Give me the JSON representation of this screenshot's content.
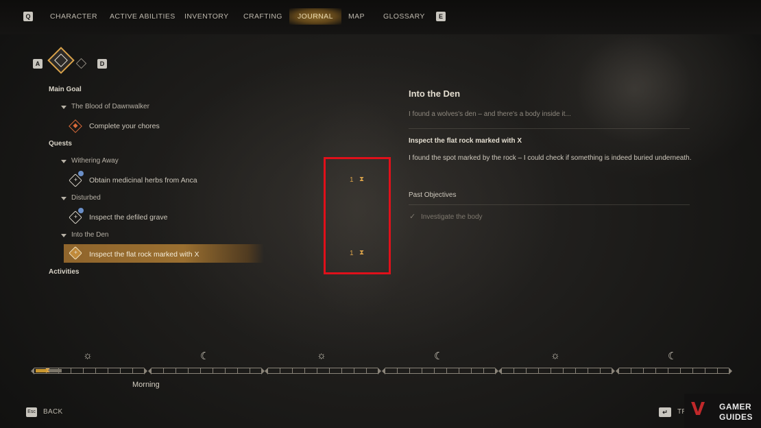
{
  "nav": {
    "left_key": "Q",
    "right_key": "E",
    "tabs": [
      {
        "label": "CHARACTER"
      },
      {
        "label": "ACTIVE ABILITIES"
      },
      {
        "label": "INVENTORY"
      },
      {
        "label": "CRAFTING"
      },
      {
        "label": "JOURNAL"
      },
      {
        "label": "MAP"
      },
      {
        "label": "GLOSSARY"
      }
    ],
    "active_tab": "JOURNAL"
  },
  "subnav": {
    "left_key": "A",
    "right_key": "D"
  },
  "journal": {
    "sections": {
      "main_goal": "Main Goal",
      "quests": "Quests",
      "activities": "Activities"
    },
    "main_goal_quest": "The Blood of Dawnwalker",
    "main_goal_objective": "Complete your chores",
    "quests": [
      {
        "name": "Withering Away",
        "objective": "Obtain medicinal herbs from Anca",
        "timer": "1"
      },
      {
        "name": "Disturbed",
        "objective": "Inspect the defiled grave"
      },
      {
        "name": "Into the Den",
        "objective": "Inspect the flat rock marked with X",
        "timer": "1",
        "selected": true
      }
    ]
  },
  "detail": {
    "title": "Into the Den",
    "description": "I found a wolves's den – and there's a body inside it...",
    "objective_title": "Inspect the flat rock marked with X",
    "objective_description": "I found the spot marked by the rock – I could check if something is indeed buried underneath.",
    "past_objectives_label": "Past Objectives",
    "past_objectives": [
      "Investigate the body"
    ]
  },
  "timeline": {
    "current_period": "Morning",
    "icons": [
      "sun-icon",
      "moon-icon",
      "sun-icon",
      "moon-icon",
      "sun-icon",
      "moon-icon"
    ],
    "progress": 0.24
  },
  "footer": {
    "back_key": "Esc",
    "back_label": "BACK",
    "track_label": "TRA"
  },
  "logo": {
    "line1": "GAMER",
    "line2": "GUIDES"
  },
  "colors": {
    "accent": "#c8962f",
    "highlight_box": "#e0101a"
  }
}
